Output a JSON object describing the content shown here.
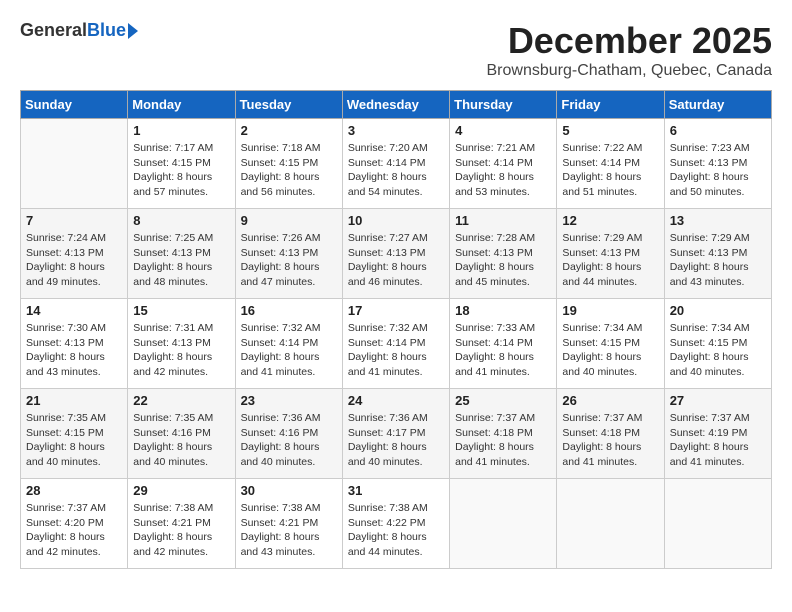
{
  "header": {
    "logo_general": "General",
    "logo_blue": "Blue",
    "month_title": "December 2025",
    "location": "Brownsburg-Chatham, Quebec, Canada"
  },
  "weekdays": [
    "Sunday",
    "Monday",
    "Tuesday",
    "Wednesday",
    "Thursday",
    "Friday",
    "Saturday"
  ],
  "weeks": [
    [
      {
        "day": "",
        "empty": true
      },
      {
        "day": "1",
        "sunrise": "7:17 AM",
        "sunset": "4:15 PM",
        "daylight": "8 hours and 57 minutes."
      },
      {
        "day": "2",
        "sunrise": "7:18 AM",
        "sunset": "4:15 PM",
        "daylight": "8 hours and 56 minutes."
      },
      {
        "day": "3",
        "sunrise": "7:20 AM",
        "sunset": "4:14 PM",
        "daylight": "8 hours and 54 minutes."
      },
      {
        "day": "4",
        "sunrise": "7:21 AM",
        "sunset": "4:14 PM",
        "daylight": "8 hours and 53 minutes."
      },
      {
        "day": "5",
        "sunrise": "7:22 AM",
        "sunset": "4:14 PM",
        "daylight": "8 hours and 51 minutes."
      },
      {
        "day": "6",
        "sunrise": "7:23 AM",
        "sunset": "4:13 PM",
        "daylight": "8 hours and 50 minutes."
      }
    ],
    [
      {
        "day": "7",
        "sunrise": "7:24 AM",
        "sunset": "4:13 PM",
        "daylight": "8 hours and 49 minutes."
      },
      {
        "day": "8",
        "sunrise": "7:25 AM",
        "sunset": "4:13 PM",
        "daylight": "8 hours and 48 minutes."
      },
      {
        "day": "9",
        "sunrise": "7:26 AM",
        "sunset": "4:13 PM",
        "daylight": "8 hours and 47 minutes."
      },
      {
        "day": "10",
        "sunrise": "7:27 AM",
        "sunset": "4:13 PM",
        "daylight": "8 hours and 46 minutes."
      },
      {
        "day": "11",
        "sunrise": "7:28 AM",
        "sunset": "4:13 PM",
        "daylight": "8 hours and 45 minutes."
      },
      {
        "day": "12",
        "sunrise": "7:29 AM",
        "sunset": "4:13 PM",
        "daylight": "8 hours and 44 minutes."
      },
      {
        "day": "13",
        "sunrise": "7:29 AM",
        "sunset": "4:13 PM",
        "daylight": "8 hours and 43 minutes."
      }
    ],
    [
      {
        "day": "14",
        "sunrise": "7:30 AM",
        "sunset": "4:13 PM",
        "daylight": "8 hours and 43 minutes."
      },
      {
        "day": "15",
        "sunrise": "7:31 AM",
        "sunset": "4:13 PM",
        "daylight": "8 hours and 42 minutes."
      },
      {
        "day": "16",
        "sunrise": "7:32 AM",
        "sunset": "4:14 PM",
        "daylight": "8 hours and 41 minutes."
      },
      {
        "day": "17",
        "sunrise": "7:32 AM",
        "sunset": "4:14 PM",
        "daylight": "8 hours and 41 minutes."
      },
      {
        "day": "18",
        "sunrise": "7:33 AM",
        "sunset": "4:14 PM",
        "daylight": "8 hours and 41 minutes."
      },
      {
        "day": "19",
        "sunrise": "7:34 AM",
        "sunset": "4:15 PM",
        "daylight": "8 hours and 40 minutes."
      },
      {
        "day": "20",
        "sunrise": "7:34 AM",
        "sunset": "4:15 PM",
        "daylight": "8 hours and 40 minutes."
      }
    ],
    [
      {
        "day": "21",
        "sunrise": "7:35 AM",
        "sunset": "4:15 PM",
        "daylight": "8 hours and 40 minutes."
      },
      {
        "day": "22",
        "sunrise": "7:35 AM",
        "sunset": "4:16 PM",
        "daylight": "8 hours and 40 minutes."
      },
      {
        "day": "23",
        "sunrise": "7:36 AM",
        "sunset": "4:16 PM",
        "daylight": "8 hours and 40 minutes."
      },
      {
        "day": "24",
        "sunrise": "7:36 AM",
        "sunset": "4:17 PM",
        "daylight": "8 hours and 40 minutes."
      },
      {
        "day": "25",
        "sunrise": "7:37 AM",
        "sunset": "4:18 PM",
        "daylight": "8 hours and 41 minutes."
      },
      {
        "day": "26",
        "sunrise": "7:37 AM",
        "sunset": "4:18 PM",
        "daylight": "8 hours and 41 minutes."
      },
      {
        "day": "27",
        "sunrise": "7:37 AM",
        "sunset": "4:19 PM",
        "daylight": "8 hours and 41 minutes."
      }
    ],
    [
      {
        "day": "28",
        "sunrise": "7:37 AM",
        "sunset": "4:20 PM",
        "daylight": "8 hours and 42 minutes."
      },
      {
        "day": "29",
        "sunrise": "7:38 AM",
        "sunset": "4:21 PM",
        "daylight": "8 hours and 42 minutes."
      },
      {
        "day": "30",
        "sunrise": "7:38 AM",
        "sunset": "4:21 PM",
        "daylight": "8 hours and 43 minutes."
      },
      {
        "day": "31",
        "sunrise": "7:38 AM",
        "sunset": "4:22 PM",
        "daylight": "8 hours and 44 minutes."
      },
      {
        "day": "",
        "empty": true
      },
      {
        "day": "",
        "empty": true
      },
      {
        "day": "",
        "empty": true
      }
    ]
  ]
}
